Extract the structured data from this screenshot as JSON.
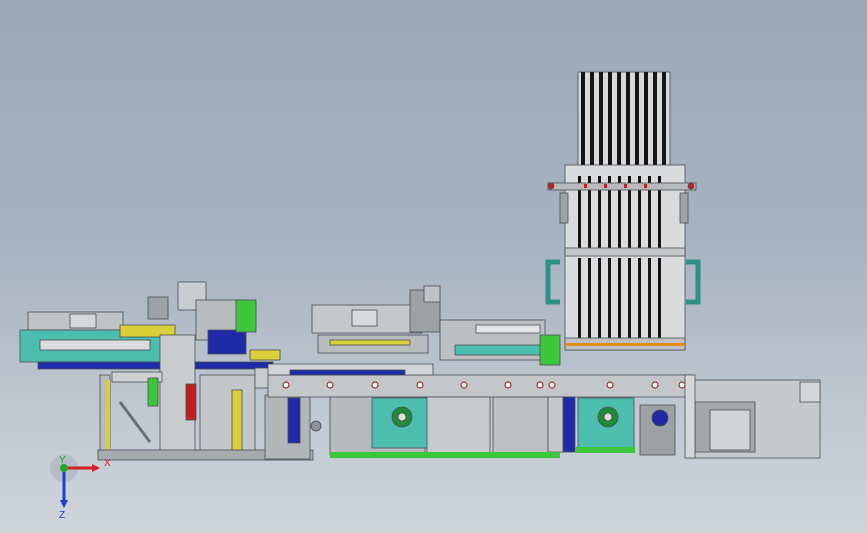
{
  "viewport": {
    "background_top": "#9aa8b8",
    "background_bottom": "#cfd4da"
  },
  "model": {
    "frame_color": "#c9cccf",
    "frame_dark": "#5d6166",
    "teal": "#4dbdb0",
    "blue": "#1e2aa8",
    "yellow": "#d8cf3a",
    "green": "#3cc63c",
    "red": "#c02020",
    "magazine_dark": "#1a1a1a"
  },
  "triad": {
    "x_label": "X",
    "y_label": "Y",
    "z_label": "Z",
    "x_color": "#d42020",
    "y_color": "#1ea82e",
    "z_color": "#2040c8"
  }
}
